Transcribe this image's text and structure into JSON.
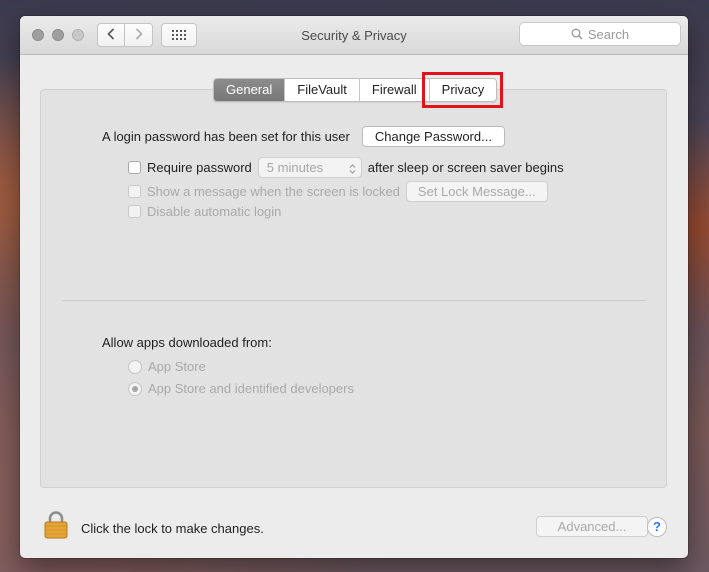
{
  "window": {
    "title": "Security & Privacy",
    "search_placeholder": "Search"
  },
  "tabs": [
    {
      "label": "General",
      "active": true
    },
    {
      "label": "FileVault",
      "active": false
    },
    {
      "label": "Firewall",
      "active": false
    },
    {
      "label": "Privacy",
      "active": false,
      "highlighted": true
    }
  ],
  "general": {
    "login_password_text": "A login password has been set for this user",
    "change_password_label": "Change Password...",
    "require_password": {
      "label": "Require password",
      "checked": false,
      "select_value": "5 minutes",
      "suffix": "after sleep or screen saver begins"
    },
    "show_message": {
      "label": "Show a message when the screen is locked",
      "checked": false,
      "enabled": false,
      "button_label": "Set Lock Message..."
    },
    "disable_auto_login": {
      "label": "Disable automatic login",
      "checked": false,
      "enabled": false
    }
  },
  "allow_apps": {
    "heading": "Allow apps downloaded from:",
    "options": [
      {
        "label": "App Store",
        "selected": false
      },
      {
        "label": "App Store and identified developers",
        "selected": true
      }
    ]
  },
  "footer": {
    "lock_text": "Click the lock to make changes.",
    "advanced_label": "Advanced...",
    "help_label": "?"
  },
  "colors": {
    "active_tab": "#7f7f7f",
    "highlight": "#e0151b",
    "help_blue": "#2f7bf4",
    "lock_gold": "#e6a436"
  }
}
